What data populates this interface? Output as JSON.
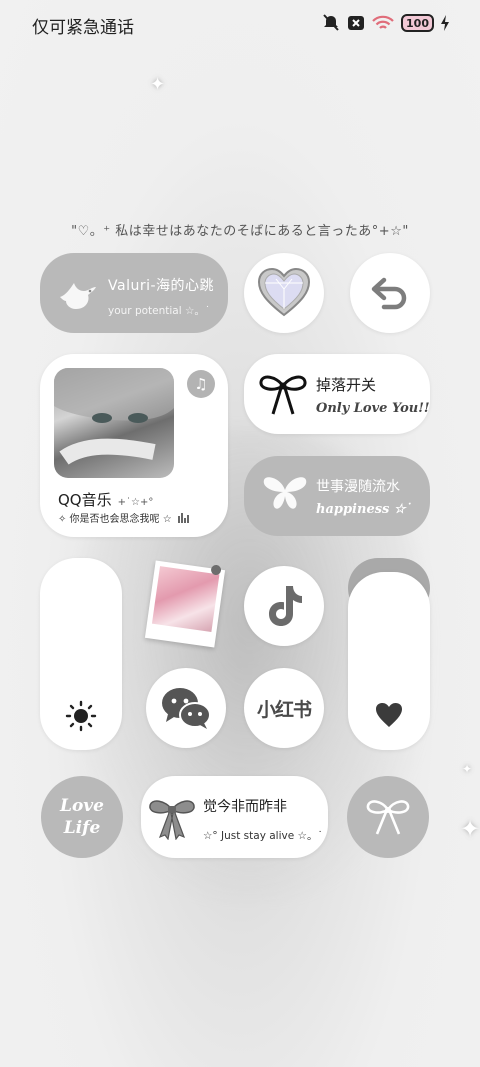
{
  "status_bar": {
    "carrier": "仅可紧急通话",
    "battery": "100",
    "icons": [
      "mute-icon",
      "no-sim-icon",
      "wifi-icon",
      "battery-icon",
      "charging-icon"
    ]
  },
  "quote": "\"♡。⁺ 私は幸せはあなたのそばにあると言ったあ°+☆\"",
  "widgets": {
    "valuri": {
      "title": "Valuri-海的心跳",
      "subtitle": "your potential ☆。˙"
    },
    "music": {
      "app_name": "QQ音乐",
      "decor": "+˙☆+°",
      "lyric": "✧ 你是否也会思念我呢 ☆"
    },
    "toggle": {
      "title": "掉落开关",
      "subtitle": "Only Love You!!"
    },
    "flow": {
      "title": "世事漫随流水",
      "subtitle": "happiness ☆˙"
    },
    "xiaohongshu": {
      "label": "小红书"
    },
    "love_life": {
      "line1": "Love",
      "line2": "Life"
    },
    "dream": {
      "title": "觉今非而昨非",
      "subtitle": "☆° Just stay alive ☆。˙"
    }
  },
  "colors": {
    "widget_gray": "#b9b9b9",
    "widget_white": "#ffffff",
    "icon_dark": "#2a2a2a",
    "background": "#efefef"
  }
}
